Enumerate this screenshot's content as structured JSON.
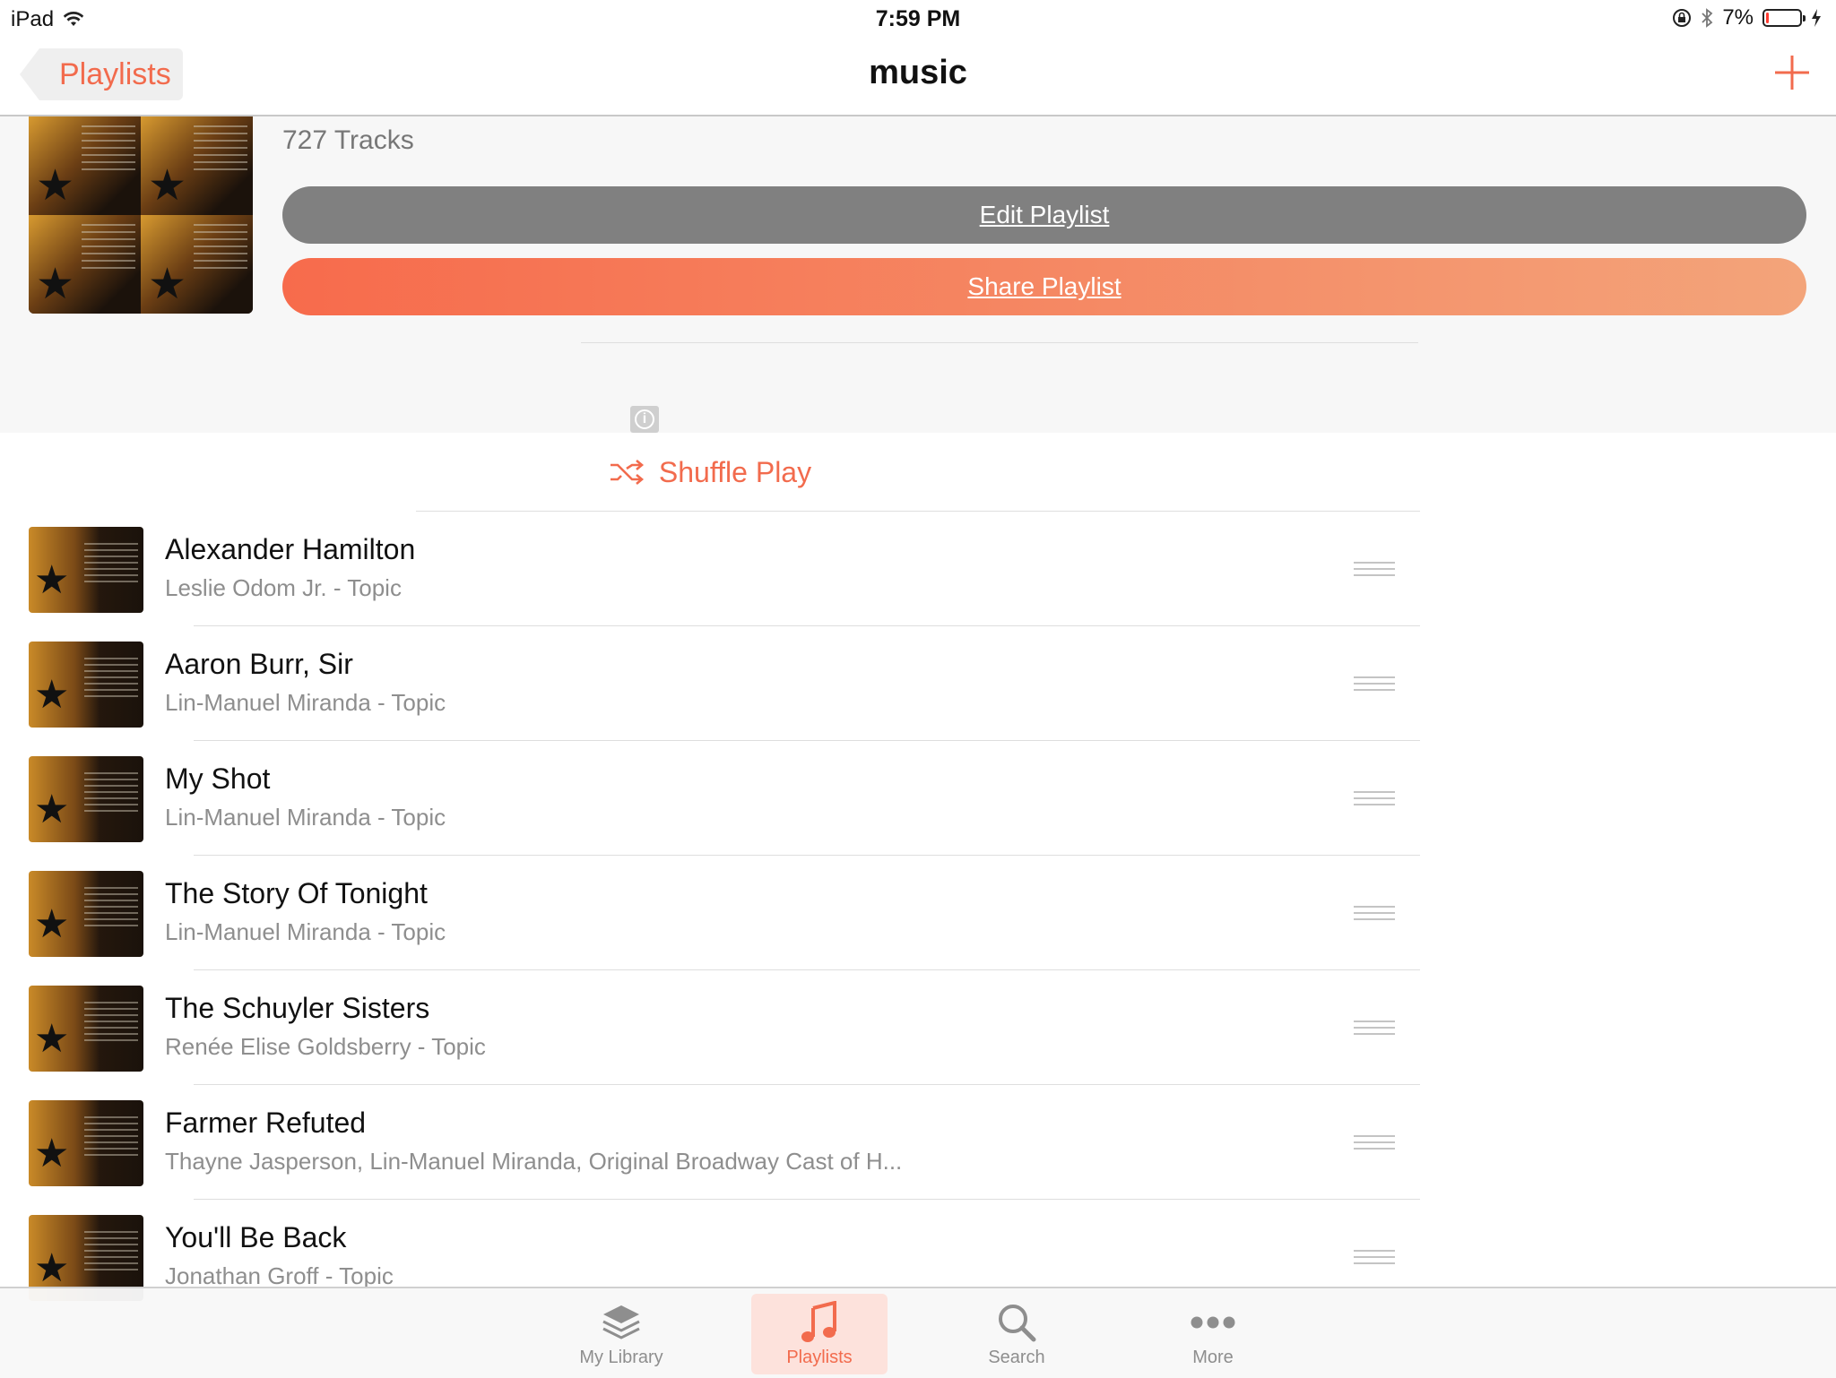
{
  "status_bar": {
    "device": "iPad",
    "time": "7:59 PM",
    "battery": "7%",
    "battery_level": 0.07
  },
  "nav": {
    "back_label": "Playlists",
    "title": "music",
    "accent": "#f26b4d"
  },
  "playlist": {
    "track_count": "727 Tracks",
    "edit_label": "Edit Playlist",
    "share_label": "Share Playlist"
  },
  "shuffle_label": "Shuffle Play",
  "tracks": [
    {
      "title": "Alexander Hamilton",
      "artist": "Leslie Odom Jr. - Topic"
    },
    {
      "title": "Aaron Burr, Sir",
      "artist": "Lin-Manuel Miranda - Topic"
    },
    {
      "title": "My Shot",
      "artist": "Lin-Manuel Miranda - Topic"
    },
    {
      "title": "The Story Of Tonight",
      "artist": "Lin-Manuel Miranda - Topic"
    },
    {
      "title": "The Schuyler Sisters",
      "artist": "Renée Elise Goldsberry - Topic"
    },
    {
      "title": "Farmer Refuted",
      "artist": "Thayne Jasperson, Lin-Manuel Miranda, Original Broadway Cast of H..."
    },
    {
      "title": "You'll Be Back",
      "artist": "Jonathan Groff - Topic"
    }
  ],
  "tabs": [
    {
      "label": "My Library",
      "icon": "layers-icon"
    },
    {
      "label": "Playlists",
      "icon": "music-note-icon",
      "active": true
    },
    {
      "label": "Search",
      "icon": "search-icon"
    },
    {
      "label": "More",
      "icon": "more-icon"
    }
  ]
}
